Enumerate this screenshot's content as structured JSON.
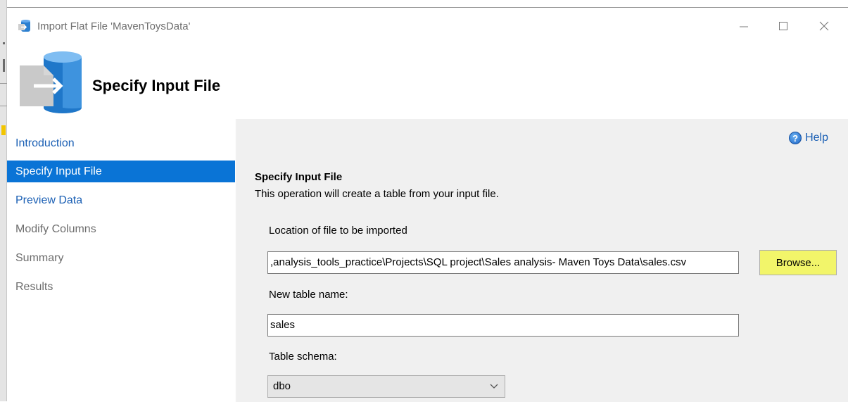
{
  "window": {
    "title": "Import Flat File 'MavenToysData'"
  },
  "banner": {
    "title": "Specify Input File"
  },
  "nav": {
    "items": [
      {
        "label": "Introduction",
        "state": "link"
      },
      {
        "label": "Specify Input File",
        "state": "selected"
      },
      {
        "label": "Preview Data",
        "state": "link"
      },
      {
        "label": "Modify Columns",
        "state": "disabled"
      },
      {
        "label": "Summary",
        "state": "disabled"
      },
      {
        "label": "Results",
        "state": "disabled"
      }
    ]
  },
  "help": {
    "label": "Help"
  },
  "section": {
    "title": "Specify Input File",
    "description": "This operation will create a table from your input file."
  },
  "file_location": {
    "label": "Location of file to be imported",
    "value": ",analysis_tools_practice\\Projects\\SQL project\\Sales analysis- Maven Toys Data\\sales.csv",
    "browse_label": "Browse..."
  },
  "table_name": {
    "label": "New table name:",
    "value": "sales"
  },
  "table_schema": {
    "label": "Table schema:",
    "value": "dbo"
  },
  "colors": {
    "selected_nav": "#0a74d6",
    "link": "#1a5fb4",
    "browse_highlight": "#f2f56a"
  }
}
